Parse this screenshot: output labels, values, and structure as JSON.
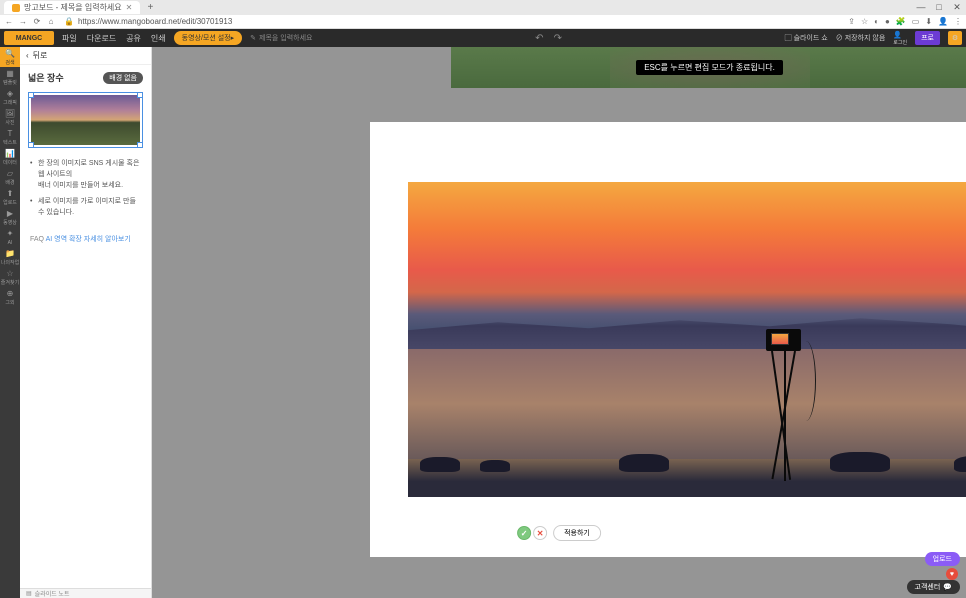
{
  "browser": {
    "tab_title": "망고보드 - 제목을 입력하세요",
    "url": "https://www.mangoboard.net/edit/30701913",
    "window": {
      "min": "—",
      "max": "□",
      "close": "✕"
    }
  },
  "header": {
    "logo": "MANGC",
    "menu": {
      "file": "파일",
      "download": "다운로드",
      "share": "공유",
      "print": "인쇄"
    },
    "warning_btn": "동영상/모션 설정▸",
    "title_placeholder": "제목을 입력하세요",
    "slideshow": "슬라이드 쇼",
    "save_status": "저장하지 않음",
    "login": "로그인",
    "pro": "프로"
  },
  "rail": {
    "items": [
      {
        "label": "검색"
      },
      {
        "label": "템플릿"
      },
      {
        "label": "그래픽"
      },
      {
        "label": "사진"
      },
      {
        "label": "텍스트"
      },
      {
        "label": "데이터"
      },
      {
        "label": "배경"
      },
      {
        "label": "업로드"
      },
      {
        "label": "동영상"
      },
      {
        "label": "AI"
      },
      {
        "label": "나의작업"
      },
      {
        "label": "즐겨찾기"
      },
      {
        "label": "그외"
      }
    ]
  },
  "panel": {
    "back": "뒤로",
    "title": "넓은 장수",
    "badge": "배경 없음",
    "desc1": "한 장의 이미지로 SNS 게시물 혹은 웹 사이트의",
    "desc1b": "배너 이미지를 만들어 보세요.",
    "desc2": "세로 이미지를 가로 이미지로 만들 수 있습니다.",
    "faq_label": "FAQ",
    "faq_link": "AI 영역 확장 자세히 알아보기"
  },
  "canvas": {
    "esc_tooltip": "ESC를 누르면 편집 모드가 종료됩니다.",
    "apply_btn": "적용하기"
  },
  "bottom": {
    "slide_toggle": "슬라이드 노트"
  },
  "floating": {
    "purple": "업로드",
    "dark": "고객센터"
  }
}
